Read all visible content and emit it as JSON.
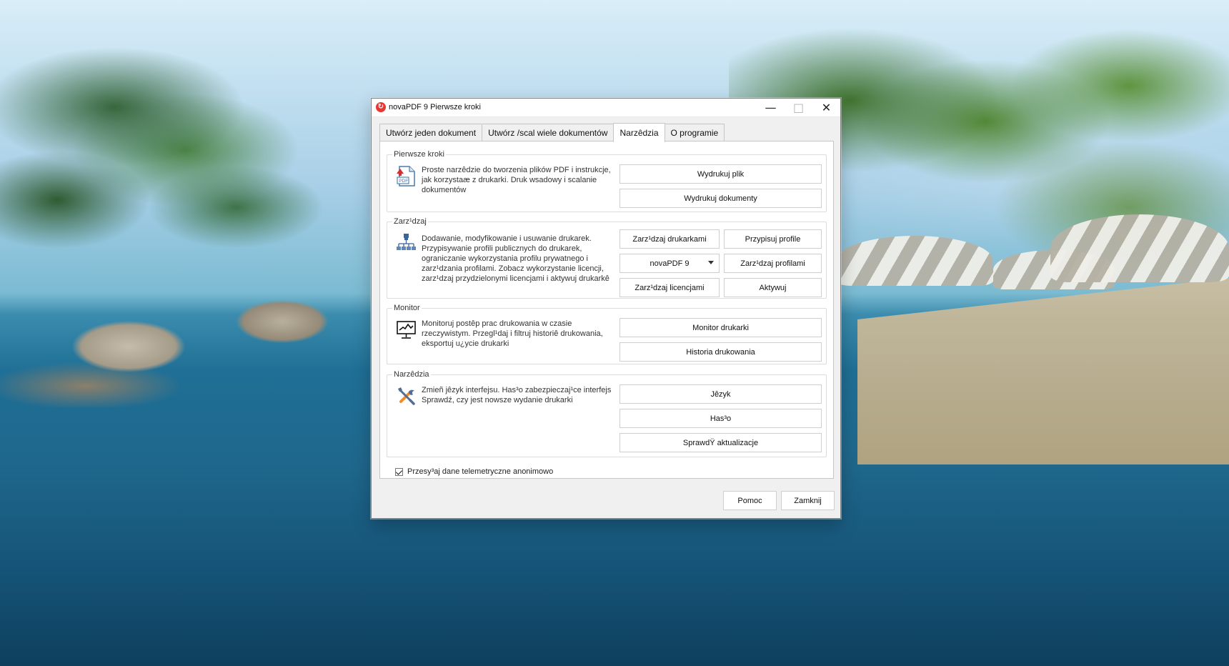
{
  "window": {
    "title": "novaPDF 9 Pierwsze kroki",
    "controls": {
      "minimize": "—",
      "maximize": "□",
      "close": "✕"
    }
  },
  "tabs": [
    {
      "label": "Utwórz jeden dokument"
    },
    {
      "label": "Utwórz /scal wiele dokumentów"
    },
    {
      "label": "Narzêdzia"
    },
    {
      "label": "O programie"
    }
  ],
  "sections": {
    "pierwsze_kroki": {
      "title": "Pierwsze kroki",
      "description": "Proste narzêdzie do tworzenia plików PDF i instrukcje, jak korzystaæ z drukarki. Druk wsadowy i scalanie dokumentów",
      "buttons": {
        "print_file": "Wydrukuj plik",
        "print_documents": "Wydrukuj dokumenty"
      }
    },
    "zarzadzaj": {
      "title": "Zarz¹dzaj",
      "description": "Dodawanie, modyfikowanie i usuwanie drukarek. Przypisywanie profili publicznych do drukarek, ograniczanie wykorzystania profilu prywatnego i zarz¹dzania profilami. Zobacz wykorzystanie licencji, zarz¹dzaj przydzielonymi licencjami i aktywuj drukarkê",
      "buttons": {
        "manage_printers": "Zarz¹dzaj drukarkami",
        "assign_profiles": "Przypisuj profile",
        "printer_select": "novaPDF 9",
        "manage_profiles": "Zarz¹dzaj profilami",
        "manage_licenses": "Zarz¹dzaj licencjami",
        "activate": "Aktywuj"
      }
    },
    "monitor": {
      "title": "Monitor",
      "description": "Monitoruj postêp prac drukowania w czasie rzeczywistym. Przegl¹daj i filtruj historiê drukowania, eksportuj u¿ycie drukarki",
      "buttons": {
        "printer_monitor": "Monitor drukarki",
        "print_history": "Historia drukowania"
      }
    },
    "narzedzia": {
      "title": "Narzêdzia",
      "description": "Zmieñ jêzyk interfejsu. Has³o zabezpieczaj¹ce interfejs Sprawdź, czy jest nowsze wydanie drukarki",
      "buttons": {
        "language": "Jêzyk",
        "password": "Has³o",
        "check_updates": "SprawdŸ aktualizacje"
      }
    }
  },
  "telemetry": {
    "label": "Przesy³aj dane telemetryczne anonimowo",
    "checked": true
  },
  "footer": {
    "help": "Pomoc",
    "close": "Zamknij"
  },
  "colors": {
    "window_bg": "#f0f0f0",
    "panel_bg": "#ffffff",
    "accent_red": "#e53935"
  },
  "icons": {
    "window": "novapdf-icon",
    "pdf": "pdf-icon",
    "network": "network-icon",
    "monitor": "monitor-icon",
    "tools": "tools-icon"
  }
}
